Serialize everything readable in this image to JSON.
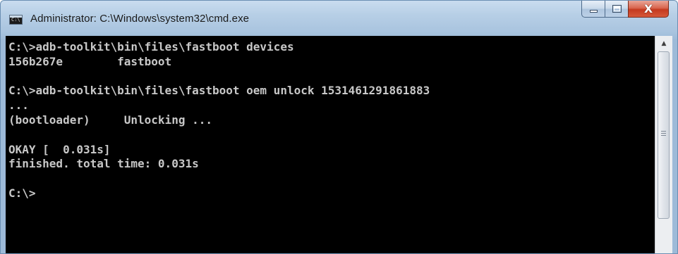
{
  "window": {
    "title": "Administrator: C:\\Windows\\system32\\cmd.exe",
    "icon": "cmd-icon"
  },
  "caption_buttons": {
    "minimize": "minimize-icon",
    "maximize": "maximize-icon",
    "close": "close-icon",
    "close_glyph": "X"
  },
  "console": {
    "lines": [
      "C:\\>adb-toolkit\\bin\\files\\fastboot devices",
      "156b267e        fastboot",
      "",
      "C:\\>adb-toolkit\\bin\\files\\fastboot oem unlock 1531461291861883",
      "...",
      "(bootloader)     Unlocking ...",
      "",
      "OKAY [  0.031s]",
      "finished. total time: 0.031s",
      "",
      "C:\\>",
      "",
      "",
      ""
    ]
  },
  "scrollbar": {
    "up_arrow": "▲"
  },
  "colors": {
    "console_background": "#000000",
    "console_text": "#c8c8c8",
    "close_button": "#c43a1f"
  }
}
